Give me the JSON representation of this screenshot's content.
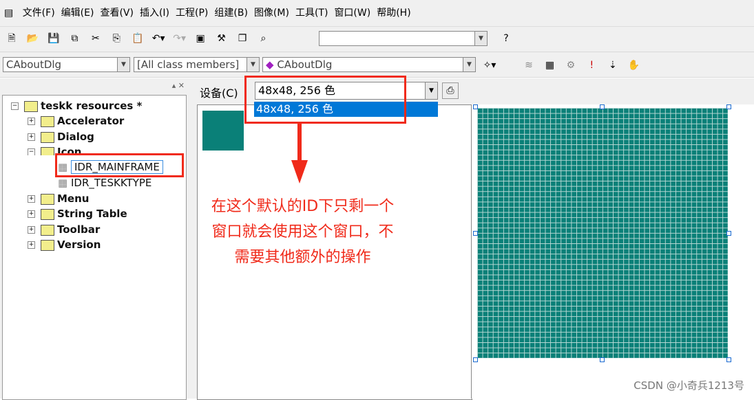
{
  "menu": [
    "文件(F)",
    "编辑(E)",
    "查看(V)",
    "插入(I)",
    "工程(P)",
    "组建(B)",
    "图像(M)",
    "工具(T)",
    "窗口(W)",
    "帮助(H)"
  ],
  "wizard": {
    "class": "CAboutDlg",
    "members": "[All class members]",
    "function": "CAboutDlg"
  },
  "tree": {
    "root": "teskk resources *",
    "items": [
      "Accelerator",
      "Dialog",
      "Icon",
      "IDR_MAINFRAME",
      "IDR_TESKKTYPE",
      "Menu",
      "String Table",
      "Toolbar",
      "Version"
    ]
  },
  "device": {
    "label": "设备(C)",
    "value": "48x48, 256 色",
    "option": "48x48, 256 色"
  },
  "annotation": [
    "在这个默认的ID下只剩一个",
    "窗口就会使用这个窗口，不",
    "需要其他额外的操作"
  ],
  "watermark": "CSDN @小奇兵1213号",
  "colors": {
    "icon": "#0a8078",
    "annotation": "#f02a1a",
    "selection": "#0078d7"
  }
}
